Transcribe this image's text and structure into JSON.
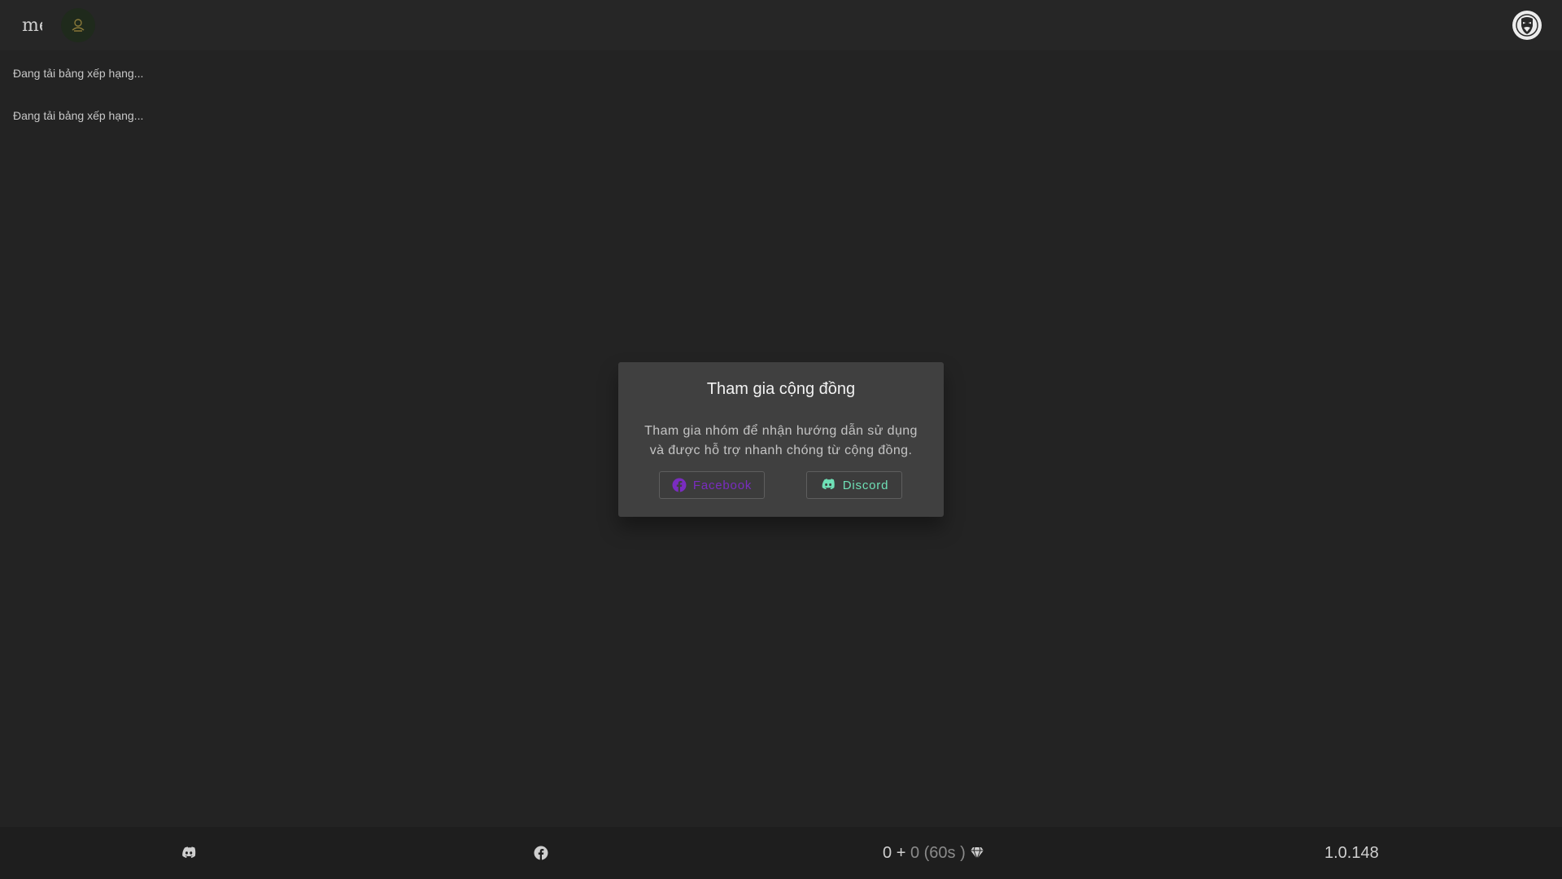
{
  "topbar": {
    "menu_text": "menu",
    "logo_icon": "community-emblem-icon",
    "avatar_icon": "anonymous-mask-icon"
  },
  "leaderboard": {
    "loading_1": "Đang tải bảng xếp hạng...",
    "loading_2": "Đang tải bảng xếp hạng..."
  },
  "modal": {
    "title": "Tham gia cộng đồng",
    "body_line1": "Tham gia nhóm để nhận hướng dẫn sử dụng",
    "body_line2": "và được hỗ trợ nhanh chóng từ cộng đồng.",
    "facebook_label": "Facebook",
    "discord_label": "Discord"
  },
  "footer": {
    "discord_icon": "discord-icon",
    "facebook_icon": "facebook-icon",
    "credits_value": "0",
    "plus": "+",
    "bonus_value": "0",
    "timer": "(60s )",
    "gem_icon": "gem-icon",
    "version": "1.0.148"
  },
  "colors": {
    "background": "#232323",
    "modal": "#404040",
    "footer": "#1e1e1e",
    "facebook_accent": "#7a2cc0",
    "discord_accent": "#6fe0b6"
  }
}
